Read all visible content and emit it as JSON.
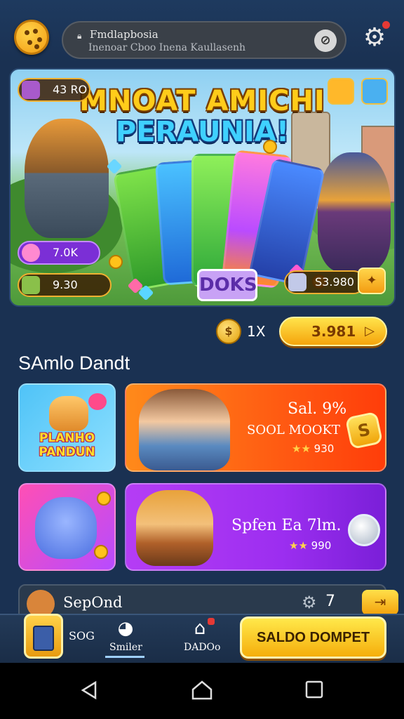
{
  "header": {
    "search_title": "Fmdlapbosia",
    "search_subtitle": "Inenoar Cboo  Inena Kaullasenh",
    "clear_icon": "clear-circle-icon",
    "settings_icon": "gear-icon"
  },
  "banner": {
    "title_line1": "MNOAT AMICHI",
    "title_line2": "PERAUNIA!",
    "center_badge": "DOKS",
    "stat_top_left": "43 RO",
    "stat_mid_left": "7.0K",
    "stat_bottom_left": "9.30",
    "stat_bottom_right": "S3.980"
  },
  "coins": {
    "multiplier": "1X",
    "button_value": "3.981"
  },
  "section": {
    "title": "SAmlo Dandt"
  },
  "tiles": [
    {
      "logo_line1": "PLANHO",
      "logo_line2": "PANDUN"
    },
    {
      "title": "Sal. 9%",
      "subtitle": "SOOL MOOKT",
      "rating": "930"
    },
    {
      "title": "Spfen Ea 7lm.",
      "rating": "990"
    }
  ],
  "promo": {
    "label": "SepOnd",
    "count": "7"
  },
  "bottom_nav": {
    "item1": "SOG",
    "item2": "Smiler",
    "item3": "DADOo",
    "wallet_button": "SALDO DOMPET"
  },
  "colors": {
    "gold": "#f5ae0c",
    "background": "#1a3152",
    "orange_tile": "#ff5a12",
    "purple_tile": "#9c2ef0"
  }
}
